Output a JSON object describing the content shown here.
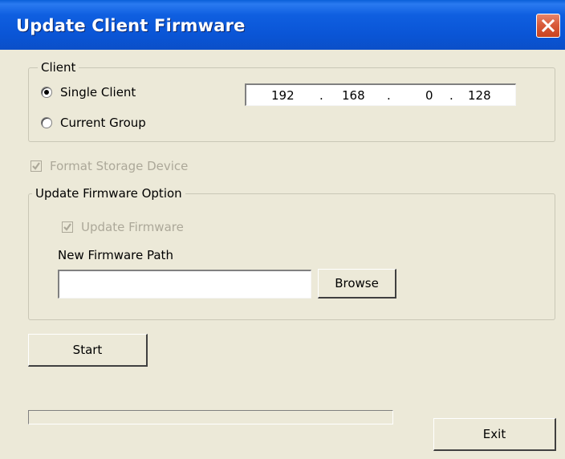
{
  "window": {
    "title": "Update Client Firmware"
  },
  "client_group": {
    "legend": "Client",
    "single_client_label": "Single Client",
    "current_group_label": "Current Group",
    "selected": "Single Client",
    "ip": [
      "192",
      "168",
      "0",
      "128"
    ],
    "ip_separator": "."
  },
  "format_storage": {
    "label": "Format Storage Device",
    "checked": true,
    "enabled": false
  },
  "firmware_group": {
    "legend": "Update Firmware Option",
    "update_firmware_label": "Update Firmware",
    "update_firmware_checked": true,
    "path_label": "New Firmware Path",
    "path_value": "",
    "browse_label": "Browse"
  },
  "actions": {
    "start_label": "Start",
    "exit_label": "Exit"
  },
  "progress": {
    "value": 0
  },
  "colors": {
    "titlebar": "#0a55d6",
    "dialog_bg": "#ece9d8",
    "disabled_text": "#aca899",
    "close_button": "#d95c3c"
  },
  "icons": {
    "close": "close-icon",
    "check": "check-icon"
  }
}
